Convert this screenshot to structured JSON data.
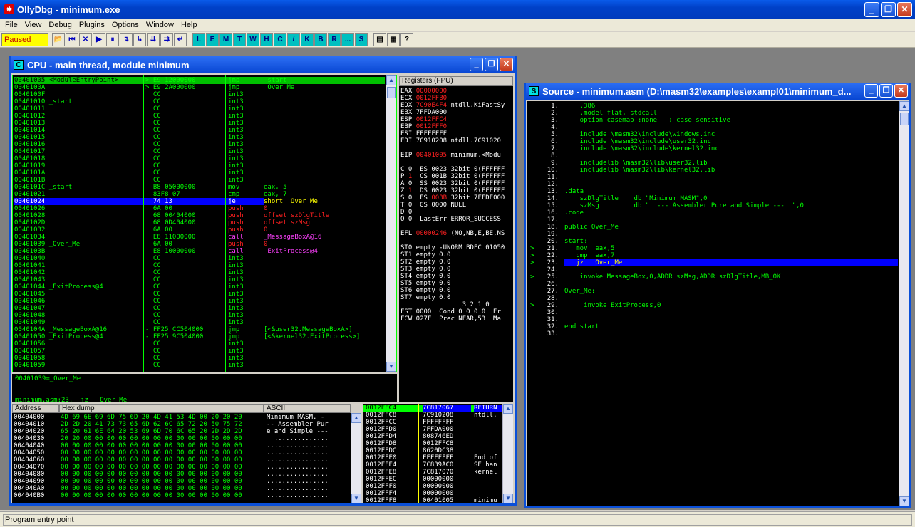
{
  "app": {
    "title": "OllyDbg - minimum.exe",
    "icon": "bug-icon"
  },
  "menu": [
    "File",
    "View",
    "Debug",
    "Plugins",
    "Options",
    "Window",
    "Help"
  ],
  "toolbar": {
    "status": "Paused",
    "buttons": [
      "📂",
      "⏮",
      "✕",
      "▶",
      "⏸",
      "↴",
      "↳",
      "⇊",
      "⇉",
      "↵"
    ],
    "letters": [
      "L",
      "E",
      "M",
      "T",
      "W",
      "H",
      "C",
      "/",
      "K",
      "B",
      "R",
      "...",
      "S"
    ],
    "tail": [
      "▤",
      "▦",
      "?"
    ]
  },
  "cpu": {
    "title": "CPU - main thread, module minimum",
    "icon": "C",
    "disasm": [
      {
        "a": "00401005 <ModuleEntryPoint>",
        "b": "> E9 12000000",
        "c": "jmp",
        "d": "_start",
        "hl": "entry"
      },
      {
        "a": "0040100A",
        "b": "> E9 2A000000",
        "c": "jmp",
        "d": "_Over_Me"
      },
      {
        "a": "0040100F",
        "b": "  CC",
        "c": "int3",
        "d": ""
      },
      {
        "a": "00401010 _start",
        "b": "  CC",
        "c": "int3",
        "d": ""
      },
      {
        "a": "00401011",
        "b": "  CC",
        "c": "int3",
        "d": ""
      },
      {
        "a": "00401012",
        "b": "  CC",
        "c": "int3",
        "d": ""
      },
      {
        "a": "00401013",
        "b": "  CC",
        "c": "int3",
        "d": ""
      },
      {
        "a": "00401014",
        "b": "  CC",
        "c": "int3",
        "d": ""
      },
      {
        "a": "00401015",
        "b": "  CC",
        "c": "int3",
        "d": ""
      },
      {
        "a": "00401016",
        "b": "  CC",
        "c": "int3",
        "d": ""
      },
      {
        "a": "00401017",
        "b": "  CC",
        "c": "int3",
        "d": ""
      },
      {
        "a": "00401018",
        "b": "  CC",
        "c": "int3",
        "d": ""
      },
      {
        "a": "00401019",
        "b": "  CC",
        "c": "int3",
        "d": ""
      },
      {
        "a": "0040101A",
        "b": "  CC",
        "c": "int3",
        "d": ""
      },
      {
        "a": "0040101B",
        "b": "  CC",
        "c": "int3",
        "d": ""
      },
      {
        "a": "0040101C _start",
        "b": "  B8 05000000",
        "c": "mov",
        "d": "eax, 5"
      },
      {
        "a": "00401021",
        "b": "  83F8 07",
        "c": "cmp",
        "d": "eax, 7"
      },
      {
        "a": "00401024",
        "b": "  74 13",
        "c": "je",
        "d": "short _Over_Me",
        "hl": "sel"
      },
      {
        "a": "00401026",
        "b": "  6A 00",
        "c": "push",
        "d": "0",
        "red": true
      },
      {
        "a": "00401028",
        "b": "  68 00404000",
        "c": "push",
        "d": "offset szDlgTitle",
        "red": true
      },
      {
        "a": "0040102D",
        "b": "  68 0D404000",
        "c": "push",
        "d": "offset szMsg",
        "red": true
      },
      {
        "a": "00401032",
        "b": "  6A 00",
        "c": "push",
        "d": "0",
        "red": true
      },
      {
        "a": "00401034",
        "b": "  E8 11000000",
        "c": "call",
        "d": "_MessageBoxA@16",
        "mag": true
      },
      {
        "a": "00401039 _Over_Me",
        "b": "  6A 00",
        "c": "push",
        "d": "0",
        "red": true
      },
      {
        "a": "0040103B",
        "b": "  E8 10000000",
        "c": "call",
        "d": "_ExitProcess@4",
        "mag": true
      },
      {
        "a": "00401040",
        "b": "  CC",
        "c": "int3",
        "d": ""
      },
      {
        "a": "00401041",
        "b": "  CC",
        "c": "int3",
        "d": ""
      },
      {
        "a": "00401042",
        "b": "  CC",
        "c": "int3",
        "d": ""
      },
      {
        "a": "00401043",
        "b": "  CC",
        "c": "int3",
        "d": ""
      },
      {
        "a": "00401044 _ExitProcess@4",
        "b": "  CC",
        "c": "int3",
        "d": ""
      },
      {
        "a": "00401045",
        "b": "  CC",
        "c": "int3",
        "d": ""
      },
      {
        "a": "00401046",
        "b": "  CC",
        "c": "int3",
        "d": ""
      },
      {
        "a": "00401047",
        "b": "  CC",
        "c": "int3",
        "d": ""
      },
      {
        "a": "00401048",
        "b": "  CC",
        "c": "int3",
        "d": ""
      },
      {
        "a": "00401049",
        "b": "  CC",
        "c": "int3",
        "d": ""
      },
      {
        "a": "0040104A _MessageBoxA@16",
        "b": "- FF25 CC504000",
        "c": "jmp",
        "d": "[<&user32.MessageBoxA>]"
      },
      {
        "a": "00401050 _ExitProcess@4",
        "b": "- FF25 9C504000",
        "c": "jmp",
        "d": "[<&kernel32.ExitProcess>]"
      },
      {
        "a": "00401056",
        "b": "  CC",
        "c": "int3",
        "d": ""
      },
      {
        "a": "00401057",
        "b": "  CC",
        "c": "int3",
        "d": ""
      },
      {
        "a": "00401058",
        "b": "  CC",
        "c": "int3",
        "d": ""
      },
      {
        "a": "00401059",
        "b": "  CC",
        "c": "int3",
        "d": ""
      }
    ],
    "info": [
      "00401039=_Over_Me",
      "",
      "",
      "minimum.asm:23.  jz   Over_Me"
    ],
    "registers_header": "Registers (FPU)",
    "registers": [
      {
        "t": "EAX ",
        "v": "00000000",
        "r": true,
        "e": ""
      },
      {
        "t": "ECX ",
        "v": "0012FFB0",
        "r": true,
        "e": ""
      },
      {
        "t": "EDX ",
        "v": "7C90E4F4",
        "r": true,
        "e": " ntdll.KiFastSy"
      },
      {
        "t": "EBX ",
        "v": "7FFDA000",
        "r": false,
        "e": ""
      },
      {
        "t": "ESP ",
        "v": "0012FFC4",
        "r": true,
        "e": ""
      },
      {
        "t": "EBP ",
        "v": "0012FFF0",
        "r": true,
        "e": ""
      },
      {
        "t": "ESI ",
        "v": "FFFFFFFF",
        "r": false,
        "e": ""
      },
      {
        "t": "EDI ",
        "v": "7C910208",
        "r": false,
        "e": " ntdll.7C91020"
      },
      {
        "t": "",
        "v": "",
        "r": false,
        "e": ""
      },
      {
        "t": "EIP ",
        "v": "00401005",
        "r": true,
        "e": " minimum.<Modu"
      },
      {
        "t": "",
        "v": "",
        "r": false,
        "e": ""
      },
      {
        "t": "C 0  ES 0023 32bit 0(FFFFFF",
        "v": "",
        "r": false,
        "e": ""
      },
      {
        "t": "P ",
        "v": "1",
        "r": true,
        "e": "  CS 001B 32bit 0(FFFFFF"
      },
      {
        "t": "A 0  SS 0023 32bit 0(FFFFFF",
        "v": "",
        "r": false,
        "e": ""
      },
      {
        "t": "Z ",
        "v": "1",
        "r": true,
        "e": "  DS 0023 32bit 0(FFFFFF"
      },
      {
        "t": "S 0  FS ",
        "v": "003B",
        "r": true,
        "e": " 32bit 7FFDF000"
      },
      {
        "t": "T 0  GS 0000 NULL",
        "v": "",
        "r": false,
        "e": ""
      },
      {
        "t": "D 0",
        "v": "",
        "r": false,
        "e": ""
      },
      {
        "t": "O 0  LastErr ERROR_SUCCESS",
        "v": "",
        "r": false,
        "e": ""
      },
      {
        "t": "",
        "v": "",
        "r": false,
        "e": ""
      },
      {
        "t": "EFL ",
        "v": "00000246",
        "r": true,
        "e": " (NO,NB,E,BE,NS"
      },
      {
        "t": "",
        "v": "",
        "r": false,
        "e": ""
      },
      {
        "t": "ST0 empty -UNORM BDEC 01050",
        "v": "",
        "r": false,
        "e": ""
      },
      {
        "t": "ST1 empty 0.0",
        "v": "",
        "r": false,
        "e": ""
      },
      {
        "t": "ST2 empty 0.0",
        "v": "",
        "r": false,
        "e": ""
      },
      {
        "t": "ST3 empty 0.0",
        "v": "",
        "r": false,
        "e": ""
      },
      {
        "t": "ST4 empty 0.0",
        "v": "",
        "r": false,
        "e": ""
      },
      {
        "t": "ST5 empty 0.0",
        "v": "",
        "r": false,
        "e": ""
      },
      {
        "t": "ST6 empty 0.0",
        "v": "",
        "r": false,
        "e": ""
      },
      {
        "t": "ST7 empty 0.0",
        "v": "",
        "r": false,
        "e": ""
      },
      {
        "t": "                3 2 1 0",
        "v": "",
        "r": false,
        "e": ""
      },
      {
        "t": "FST 0000  Cond 0 0 0 0  Er",
        "v": "",
        "r": false,
        "e": ""
      },
      {
        "t": "FCW 027F  Prec NEAR,53  Ma",
        "v": "",
        "r": false,
        "e": ""
      }
    ],
    "dump_headers": [
      "Address",
      "Hex dump",
      "ASCII"
    ],
    "dump": [
      {
        "a": "00404000",
        "h": "4D 69 6E 69 6D 75 6D 20 4D 41 53 4D 00 20 20 20",
        "s": "Minimum MASM. -"
      },
      {
        "a": "00404010",
        "h": "2D 2D 20 41 73 73 65 6D 62 6C 65 72 20 50 75 72",
        "s": "-- Assembler Pur"
      },
      {
        "a": "00404020",
        "h": "65 20 61 6E 64 20 53 69 6D 70 6C 65 20 2D 2D 2D",
        "s": "e and Simple ---"
      },
      {
        "a": "00404030",
        "h": "20 20 00 00 00 00 00 00 00 00 00 00 00 00 00 00",
        "s": "  .............."
      },
      {
        "a": "00404040",
        "h": "00 00 00 00 00 00 00 00 00 00 00 00 00 00 00 00",
        "s": "................"
      },
      {
        "a": "00404050",
        "h": "00 00 00 00 00 00 00 00 00 00 00 00 00 00 00 00",
        "s": "................"
      },
      {
        "a": "00404060",
        "h": "00 00 00 00 00 00 00 00 00 00 00 00 00 00 00 00",
        "s": "................"
      },
      {
        "a": "00404070",
        "h": "00 00 00 00 00 00 00 00 00 00 00 00 00 00 00 00",
        "s": "................"
      },
      {
        "a": "00404080",
        "h": "00 00 00 00 00 00 00 00 00 00 00 00 00 00 00 00",
        "s": "................"
      },
      {
        "a": "00404090",
        "h": "00 00 00 00 00 00 00 00 00 00 00 00 00 00 00 00",
        "s": "................"
      },
      {
        "a": "004040A0",
        "h": "00 00 00 00 00 00 00 00 00 00 00 00 00 00 00 00",
        "s": "................"
      },
      {
        "a": "004040B0",
        "h": "00 00 00 00 00 00 00 00 00 00 00 00 00 00 00 00",
        "s": "................"
      }
    ],
    "stack": [
      {
        "a": "0012FFC4",
        "v": "7C817067",
        "c": "RETURN",
        "sel": true
      },
      {
        "a": "0012FFC8",
        "v": "7C910208",
        "c": "ntdll."
      },
      {
        "a": "0012FFCC",
        "v": "FFFFFFFF",
        "c": ""
      },
      {
        "a": "0012FFD0",
        "v": "7FFDA000",
        "c": ""
      },
      {
        "a": "0012FFD4",
        "v": "808746ED",
        "c": ""
      },
      {
        "a": "0012FFD8",
        "v": "0012FFC8",
        "c": ""
      },
      {
        "a": "0012FFDC",
        "v": "8620DC38",
        "c": ""
      },
      {
        "a": "0012FFE0",
        "v": "FFFFFFFF",
        "c": "End of"
      },
      {
        "a": "0012FFE4",
        "v": "7C839AC0",
        "c": "SE han"
      },
      {
        "a": "0012FFE8",
        "v": "7C817070",
        "c": "kernel"
      },
      {
        "a": "0012FFEC",
        "v": "00000000",
        "c": ""
      },
      {
        "a": "0012FFF0",
        "v": "00000000",
        "c": ""
      },
      {
        "a": "0012FFF4",
        "v": "00000000",
        "c": ""
      },
      {
        "a": "0012FFF8",
        "v": "00401005",
        "c": "minimu"
      }
    ]
  },
  "source": {
    "title": "Source - minimum.asm (D:\\masm32\\examples\\exampl01\\minimum_d...",
    "icon": "S",
    "lines": [
      {
        "n": "1.",
        "m": "",
        "t": "    .386"
      },
      {
        "n": "2.",
        "m": "",
        "t": "    .model flat, stdcall"
      },
      {
        "n": "3.",
        "m": "",
        "t": "    option casemap :none   ; case sensitive"
      },
      {
        "n": "4.",
        "m": "",
        "t": ""
      },
      {
        "n": "5.",
        "m": "",
        "t": "    include \\masm32\\include\\windows.inc"
      },
      {
        "n": "6.",
        "m": "",
        "t": "    include \\masm32\\include\\user32.inc"
      },
      {
        "n": "7.",
        "m": "",
        "t": "    include \\masm32\\include\\kernel32.inc"
      },
      {
        "n": "8.",
        "m": "",
        "t": ""
      },
      {
        "n": "9.",
        "m": "",
        "t": "    includelib \\masm32\\lib\\user32.lib"
      },
      {
        "n": "10.",
        "m": "",
        "t": "    includelib \\masm32\\lib\\kernel32.lib"
      },
      {
        "n": "11.",
        "m": "",
        "t": ""
      },
      {
        "n": "12.",
        "m": "",
        "t": ""
      },
      {
        "n": "13.",
        "m": "",
        "t": ".data"
      },
      {
        "n": "14.",
        "m": "",
        "t": "    szDlgTitle    db \"Minimum MASM\",0"
      },
      {
        "n": "15.",
        "m": "",
        "t": "    szMsg         db \"  --- Assembler Pure and Simple ---  \",0"
      },
      {
        "n": "16.",
        "m": "",
        "t": ".code"
      },
      {
        "n": "17.",
        "m": "",
        "t": ""
      },
      {
        "n": "18.",
        "m": "",
        "t": "public Over_Me"
      },
      {
        "n": "19.",
        "m": "",
        "t": ""
      },
      {
        "n": "20.",
        "m": "",
        "t": "start:"
      },
      {
        "n": "21.",
        "m": ">",
        "t": "   mov  eax,5"
      },
      {
        "n": "22.",
        "m": ">",
        "t": "   cmp  eax,7"
      },
      {
        "n": "23.",
        "m": ">",
        "t": "   jz   Over_Me",
        "sel": true
      },
      {
        "n": "24.",
        "m": "",
        "t": ""
      },
      {
        "n": "25.",
        "m": ">",
        "t": "    invoke MessageBox,0,ADDR szMsg,ADDR szDlgTitle,MB_OK"
      },
      {
        "n": "26.",
        "m": "",
        "t": ""
      },
      {
        "n": "27.",
        "m": "",
        "t": "Over_Me:"
      },
      {
        "n": "28.",
        "m": "",
        "t": ""
      },
      {
        "n": "29.",
        "m": ">",
        "t": "     invoke ExitProcess,0"
      },
      {
        "n": "30.",
        "m": "",
        "t": ""
      },
      {
        "n": "31.",
        "m": "",
        "t": ""
      },
      {
        "n": "32.",
        "m": "",
        "t": "end start"
      },
      {
        "n": "33.",
        "m": "",
        "t": ""
      }
    ]
  },
  "statusbar": "Program entry point"
}
